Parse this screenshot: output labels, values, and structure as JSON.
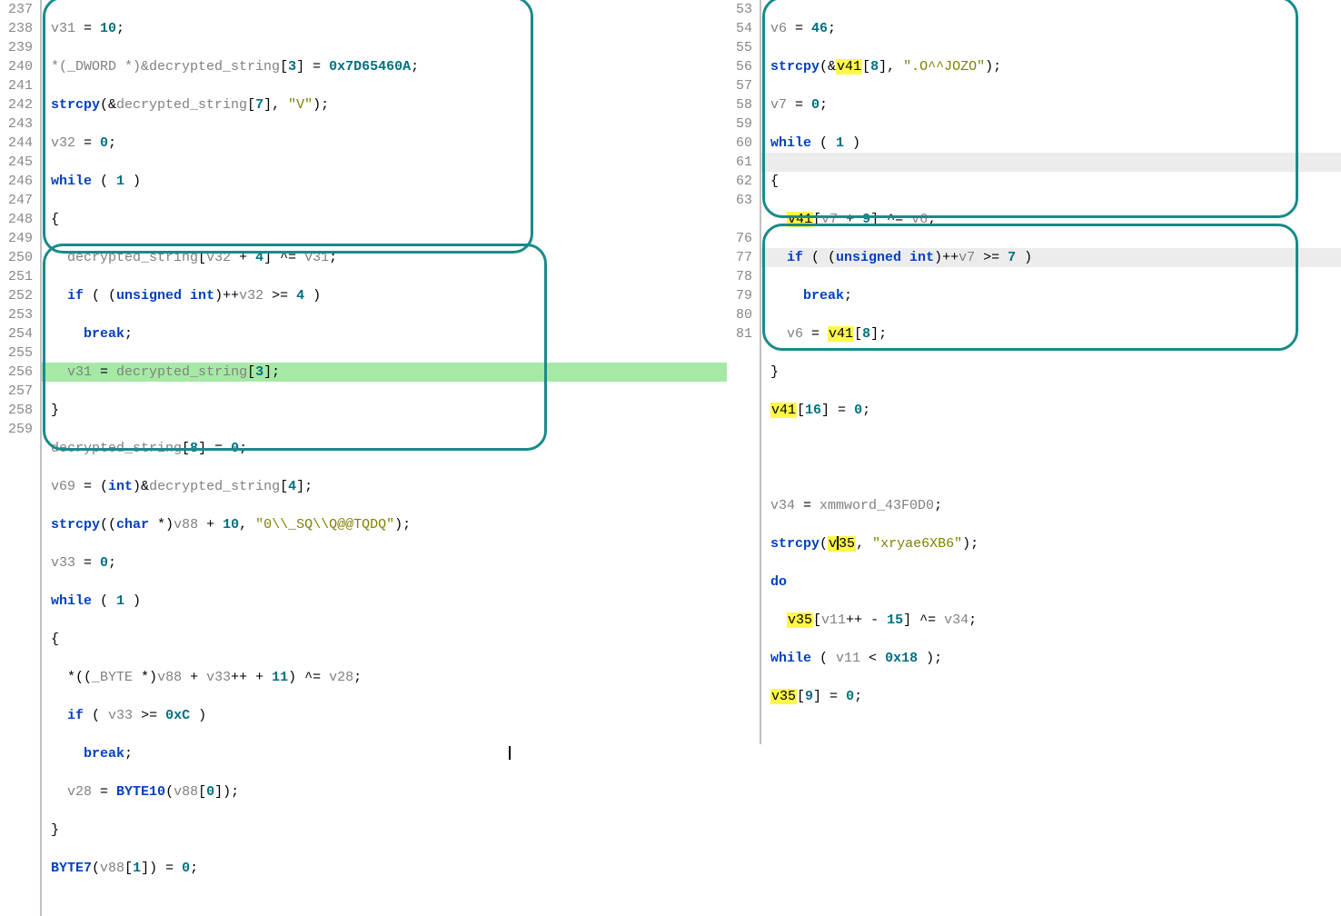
{
  "left": {
    "line_numbers": [
      "237",
      "238",
      "239",
      "240",
      "241",
      "242",
      "243",
      "244",
      "245",
      "246",
      "247",
      "248",
      "249",
      "250",
      "251",
      "252",
      "253",
      "254",
      "255",
      "256",
      "257",
      "258",
      "259"
    ],
    "lines": {
      "l237": {
        "var": "v31",
        "eq": " = ",
        "val": "10",
        "term": ";"
      },
      "l238": {
        "cast": "*(_DWORD *)&",
        "ident": "decrypted_string",
        "idx": "[",
        "n": "3",
        "idx2": "] = ",
        "hex": "0x7D65460A",
        "term": ";"
      },
      "l239": {
        "func": "strcpy",
        "open": "(&",
        "ident": "decrypted_string",
        "idx": "[",
        "n": "7",
        "idx2": "], ",
        "str": "\"V\"",
        "close": ");"
      },
      "l240": {
        "var": "v32",
        "eq": " = ",
        "val": "0",
        "term": ";"
      },
      "l241": {
        "kw": "while",
        "rest": " ( ",
        "n": "1",
        "close": " )"
      },
      "l242": {
        "brace": "{"
      },
      "l243": {
        "ident": "decrypted_string",
        "idx": "[",
        "v": "v32",
        "op": " + ",
        "n": "4",
        "idx2": "] ^= ",
        "v2": "v31",
        "term": ";"
      },
      "l244": {
        "kw": "if",
        "open": " ( (",
        "type": "unsigned int",
        "close1": ")++",
        "v": "v32",
        "op": " >= ",
        "n": "4",
        "close2": " )"
      },
      "l245": {
        "kw": "break",
        "term": ";"
      },
      "l246": {
        "v": "v31",
        "eq": " = ",
        "ident": "decrypted_string",
        "idx": "[",
        "n": "3",
        "close": "];"
      },
      "l247": {
        "brace": "}"
      },
      "l248": {
        "ident": "decrypted_string",
        "idx": "[",
        "n": "8",
        "close": "] = ",
        "val": "0",
        "term": ";"
      },
      "l249": {
        "v": "v69",
        "eq": " = (",
        "type": "int",
        "close1": ")&",
        "ident": "decrypted_string",
        "idx": "[",
        "n": "4",
        "close2": "];"
      },
      "l250": {
        "func": "strcpy",
        "open": "((",
        "type": "char",
        "close1": " *)",
        "v": "v88",
        "op": " + ",
        "n": "10",
        "comma": ", ",
        "str": "\"0\\\\_SQ\\\\Q@@TQDQ\"",
        "close2": ");"
      },
      "l251": {
        "v": "v33",
        "eq": " = ",
        "val": "0",
        "term": ";"
      },
      "l252": {
        "kw": "while",
        "rest": " ( ",
        "n": "1",
        "close": " )"
      },
      "l253": {
        "brace": "{"
      },
      "l254": {
        "open": "*((",
        "type": "_BYTE ",
        " close1": "*)",
        "v": "v88",
        "op": " + ",
        "v2": "v33",
        "inc": "++ + ",
        "n": "11",
        "close2": ") ^= ",
        "v3": "v28",
        "term": ";"
      },
      "l255": {
        "kw": "if",
        "open": " ( ",
        "v": "v33",
        "op": " >= ",
        "n": "0xC",
        "close": " )"
      },
      "l256": {
        "kw": "break",
        "term": ";"
      },
      "l257": {
        "v": "v28",
        "eq": " = ",
        "func": "BYTE10",
        "open": "(",
        "v2": "v88",
        "idx": "[",
        "n": "0",
        "close": "]);"
      },
      "l258": {
        "brace": "}"
      },
      "l259": {
        "func": "BYTE7",
        "open": "(",
        "v": "v88",
        "idx": "[",
        "n": "1",
        "close": "]) = ",
        "val": "0",
        "term": ";"
      }
    }
  },
  "right": {
    "line_numbers_top": [
      "53",
      "54",
      "55",
      "56",
      "57",
      "58",
      "59",
      "60",
      "61",
      "62",
      "63"
    ],
    "line_numbers_bot": [
      "76",
      "77",
      "78",
      "79",
      "80",
      "81"
    ],
    "lines": {
      "r53": {
        "v": "v6",
        "eq": " = ",
        "val": "46",
        "term": ";"
      },
      "r54": {
        "func": "strcpy",
        "open": "(&",
        "vh": "v41",
        "idx": "[",
        "n": "8",
        "close1": "], ",
        "str": "\".O^^JOZO\"",
        "close2": ");"
      },
      "r55": {
        "v": "v7",
        "eq": " = ",
        "val": "0",
        "term": ";"
      },
      "r56": {
        "kw": "while",
        "rest": " ( ",
        "n": "1",
        "close": " )"
      },
      "r57": {
        "brace": "{"
      },
      "r58": {
        "vh": "v41",
        "idx": "[",
        "v": "v7",
        "op": " + ",
        "n": "9",
        "close": "] ^= ",
        "v2": "v6",
        "term": ";"
      },
      "r59": {
        "kw": "if",
        "open": " ( (",
        "type": "unsigned int",
        "close1": ")++",
        "v": "v7",
        "op": " >= ",
        "n": "7",
        "close2": " )"
      },
      "r60": {
        "kw": "break",
        "term": ";"
      },
      "r61": {
        "v": "v6",
        "eq": " = ",
        "vh": "v41",
        "idx": "[",
        "n": "8",
        "close": "];"
      },
      "r62": {
        "brace": "}"
      },
      "r63": {
        "vh": "v41",
        "idx": "[",
        "n": "16",
        "close": "] = ",
        "val": "0",
        "term": ";"
      },
      "r76": {
        "v": "v34",
        "eq": " = ",
        "ident": "xmmword_43F0D0",
        "term": ";"
      },
      "r77": {
        "func": "strcpy",
        "open": "(",
        "vhpre": "v",
        "vhcur": "|",
        "vhpost": "35",
        "comma": ", ",
        "str": "\"xryae6XB6\"",
        "close": ");"
      },
      "r78": {
        "kw": "do"
      },
      "r79": {
        "vh": "v35",
        "idx": "[",
        "v": "v11",
        "inc": "++ - ",
        "n": "15",
        "close": "] ^= ",
        "v2": "v34",
        "term": ";"
      },
      "r80": {
        "kw": "while",
        "open": " ( ",
        "v": "v11",
        "op": " < ",
        "n": "0x18",
        "close": " );"
      },
      "r81": {
        "vh": "v35",
        "idx": "[",
        "n": "9",
        "close": "] = ",
        "val": "0",
        "term": ";"
      }
    }
  }
}
